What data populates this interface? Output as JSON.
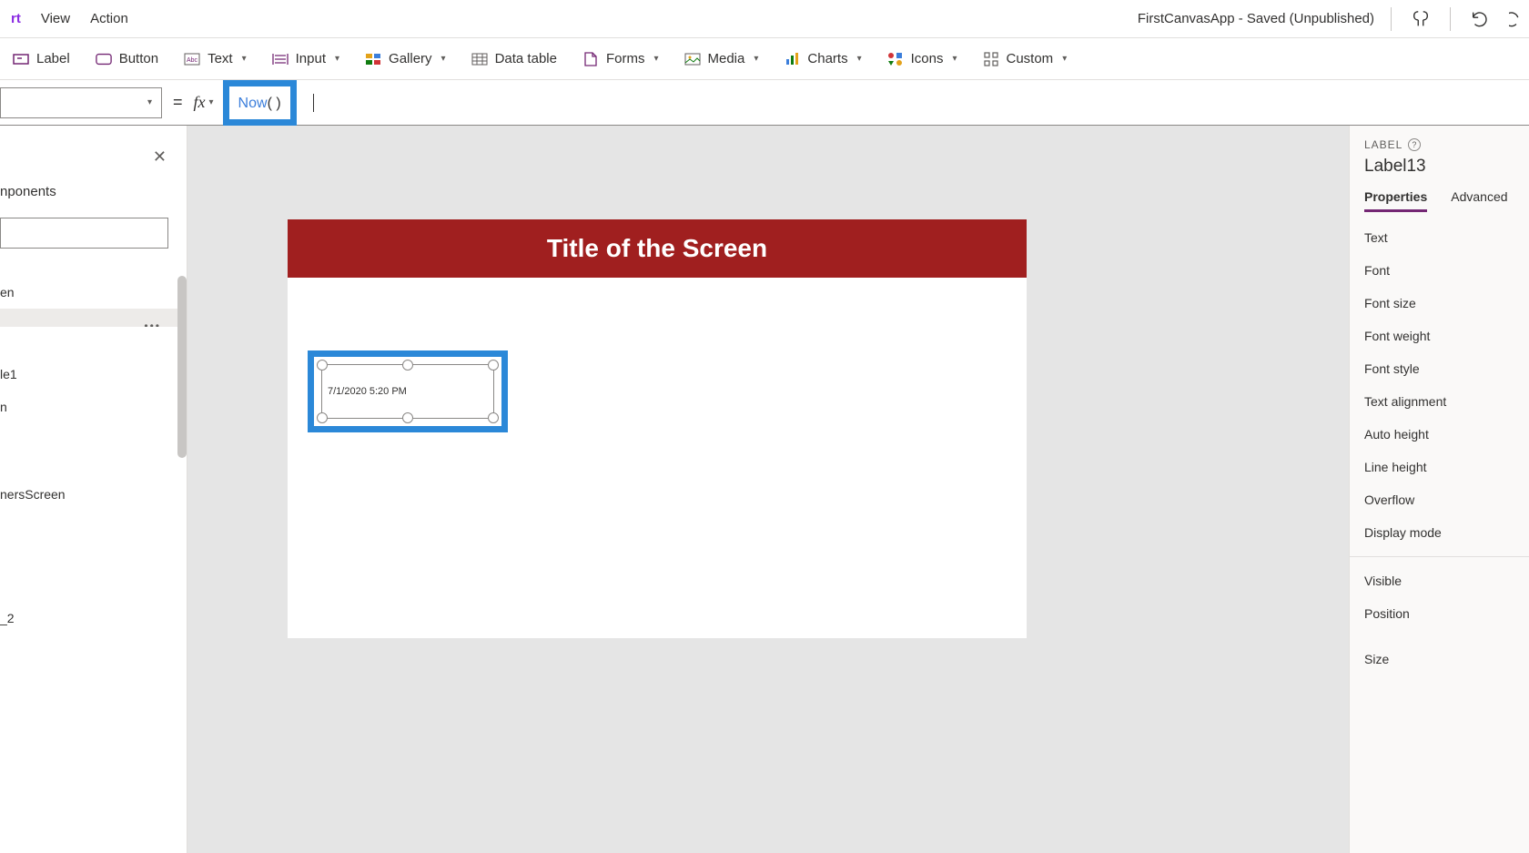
{
  "topMenu": {
    "items": [
      "rt",
      "View",
      "Action"
    ],
    "activeIndex": 0,
    "appTitle": "FirstCanvasApp - Saved (Unpublished)"
  },
  "ribbon": {
    "label": "Label",
    "button": "Button",
    "text": "Text",
    "input": "Input",
    "gallery": "Gallery",
    "datatable": "Data table",
    "forms": "Forms",
    "media": "Media",
    "charts": "Charts",
    "icons": "Icons",
    "custom": "Custom"
  },
  "formula": {
    "equals": "=",
    "fx": "fx",
    "fn": "Now",
    "paren": "( )"
  },
  "leftPanel": {
    "tabLabel": "nponents",
    "items": [
      "en",
      "",
      "le1",
      "n",
      "nersScreen",
      "_2"
    ],
    "selectedIndex": 1
  },
  "canvas": {
    "title": "Title of the Screen",
    "labelText": "7/1/2020 5:20 PM"
  },
  "rightPanel": {
    "typeLabel": "LABEL",
    "controlName": "Label13",
    "tabs": [
      "Properties",
      "Advanced"
    ],
    "activeTab": 0,
    "group1": [
      "Text",
      "Font",
      "Font size",
      "Font weight",
      "Font style",
      "Text alignment",
      "Auto height",
      "Line height",
      "Overflow",
      "Display mode"
    ],
    "group2": [
      "Visible",
      "Position",
      "Size"
    ]
  }
}
